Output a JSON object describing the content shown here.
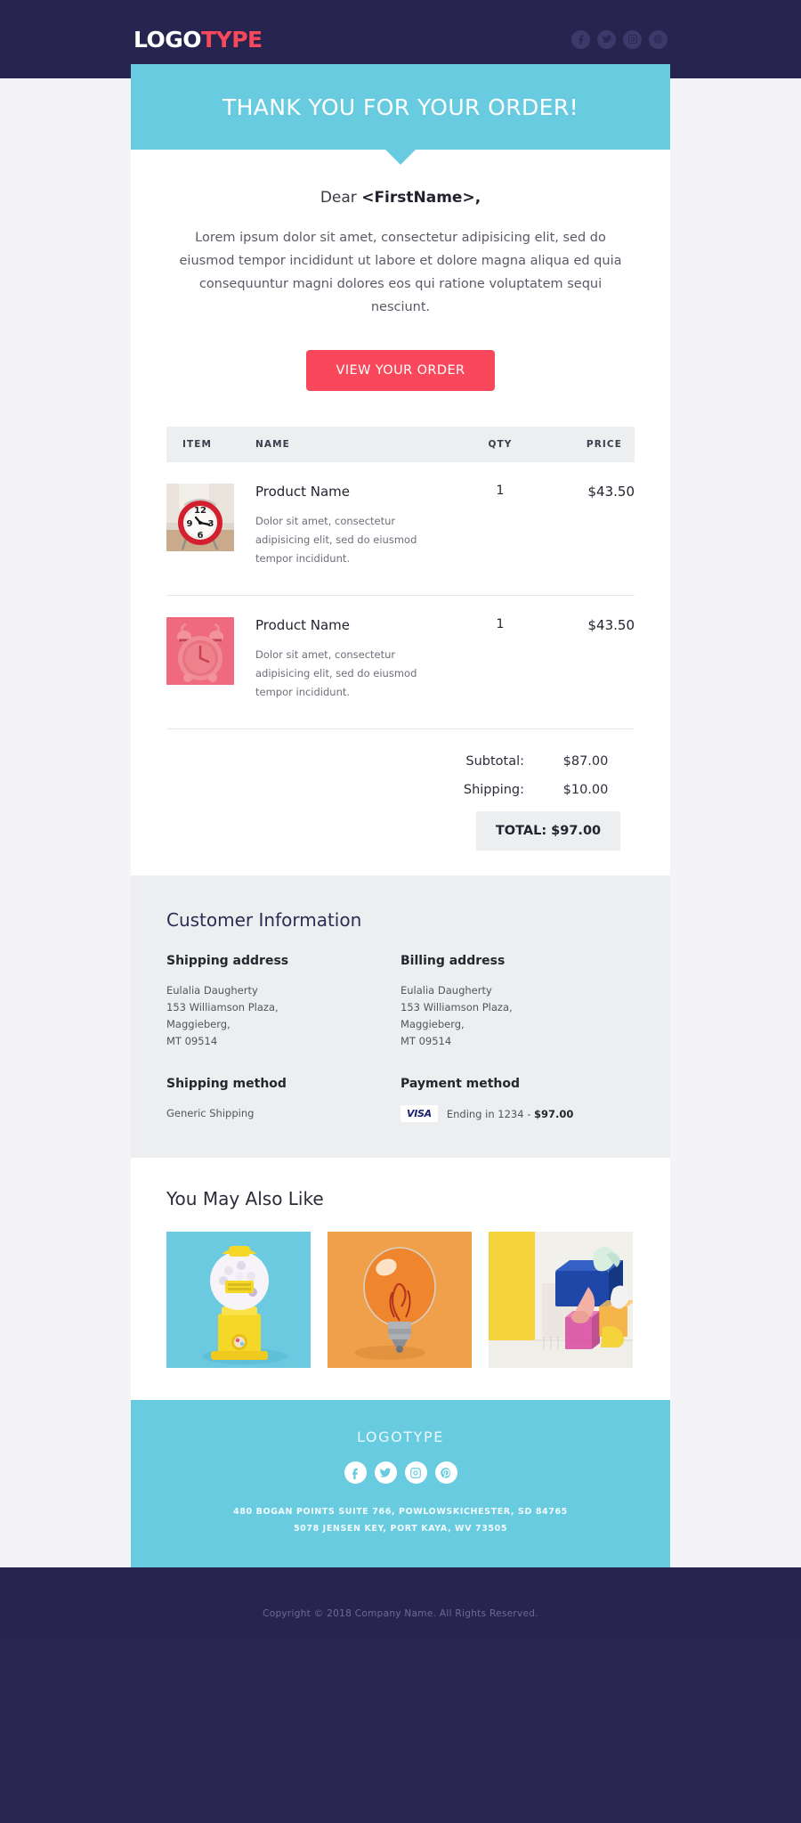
{
  "header": {
    "logo_part1": "LOGO",
    "logo_part2": "TYPE",
    "social": [
      {
        "name": "facebook-icon",
        "label": "Facebook"
      },
      {
        "name": "twitter-icon",
        "label": "Twitter"
      },
      {
        "name": "instagram-icon",
        "label": "Instagram"
      },
      {
        "name": "pinterest-icon",
        "label": "Pinterest"
      }
    ]
  },
  "hero": {
    "title": "THANK YOU FOR YOUR ORDER!",
    "bg_color": "#68cbe0"
  },
  "body": {
    "greeting_prefix": "Dear ",
    "greeting_name": "<FirstName>,",
    "intro": "Lorem ipsum dolor sit amet, consectetur adipisicing elit, sed do eiusmod tempor incididunt ut labore et dolore magna aliqua ed quia consequuntur magni dolores eos qui ratione voluptatem sequi nesciunt.",
    "cta_label": "VIEW YOUR ORDER",
    "cta_color": "#f9485b"
  },
  "order_table": {
    "columns": [
      "ITEM",
      "NAME",
      "QTY",
      "PRICE"
    ],
    "rows": [
      {
        "image": "red-alarm-clock",
        "name": "Product Name",
        "description": "Dolor sit amet, consectetur adipisicing elit, sed do eiusmod tempor incididunt.",
        "qty": "1",
        "price": "$43.50"
      },
      {
        "image": "pink-alarm-clock",
        "name": "Product Name",
        "description": "Dolor sit amet, consectetur adipisicing elit, sed do eiusmod tempor incididunt.",
        "qty": "1",
        "price": "$43.50"
      }
    ],
    "totals": {
      "subtotal_label": "Subtotal:",
      "subtotal_value": "$87.00",
      "shipping_label": "Shipping:",
      "shipping_value": "$10.00",
      "grand_total": "TOTAL: $97.00"
    }
  },
  "customer_information": {
    "title": "Customer Information",
    "shipping_address": {
      "heading": "Shipping address",
      "line1": "Eulalia Daugherty",
      "line2": "153 Williamson Plaza,",
      "line3": "Maggieberg,",
      "line4": "MT 09514"
    },
    "billing_address": {
      "heading": "Billing address",
      "line1": "Eulalia Daugherty",
      "line2": "153 Williamson Plaza,",
      "line3": "Maggieberg,",
      "line4": "MT 09514"
    },
    "shipping_method": {
      "heading": "Shipping method",
      "value": "Generic Shipping"
    },
    "payment_method": {
      "heading": "Payment method",
      "card_brand": "VISA",
      "detail_prefix": "Ending in 1234 - ",
      "detail_amount": "$97.00"
    }
  },
  "also_like": {
    "title": "You May Also Like",
    "items": [
      {
        "name": "gumball-machine",
        "bg": "#6ccae0"
      },
      {
        "name": "orange-light-bulb",
        "bg": "#f0a04b"
      },
      {
        "name": "colored-plastic-blocks",
        "bg": "#f5d33b"
      }
    ]
  },
  "footer": {
    "logo": "LOGOTYPE",
    "social": [
      {
        "name": "facebook-icon",
        "label": "Facebook"
      },
      {
        "name": "twitter-icon",
        "label": "Twitter"
      },
      {
        "name": "instagram-icon",
        "label": "Instagram"
      },
      {
        "name": "pinterest-icon",
        "label": "Pinterest"
      }
    ],
    "address_line1": "480 BOGAN POINTS SUITE 766, POWLOWSKICHESTER, SD 84765",
    "address_line2": "5078 JENSEN KEY, PORT KAYA, WV 73505",
    "bg_color": "#68cbe0"
  },
  "bottom": {
    "copyright": "Copyright © 2018 Company Name. All Rights Reserved."
  }
}
